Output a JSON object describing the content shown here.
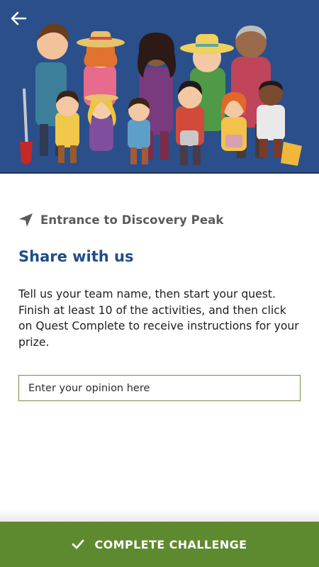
{
  "header": {
    "back_icon": "arrow-left-icon",
    "illustration": "group-of-gardeners-illustration",
    "background_color": "#2a4f8b"
  },
  "location": {
    "icon": "navigation-arrow-icon",
    "label": "Entrance to Discovery Peak"
  },
  "content": {
    "title": "Share with us",
    "title_color": "#1f4d8a",
    "description": "Tell us your team name, then start your quest. Finish at least 10 of the activities, and then click on Quest Complete to receive instructions for your prize."
  },
  "opinion_input": {
    "value": "",
    "placeholder": "Enter your opinion here"
  },
  "footer": {
    "button_label": "COMPLETE CHALLENGE",
    "button_icon": "checkmark-icon",
    "button_color": "#5d8a2f"
  }
}
